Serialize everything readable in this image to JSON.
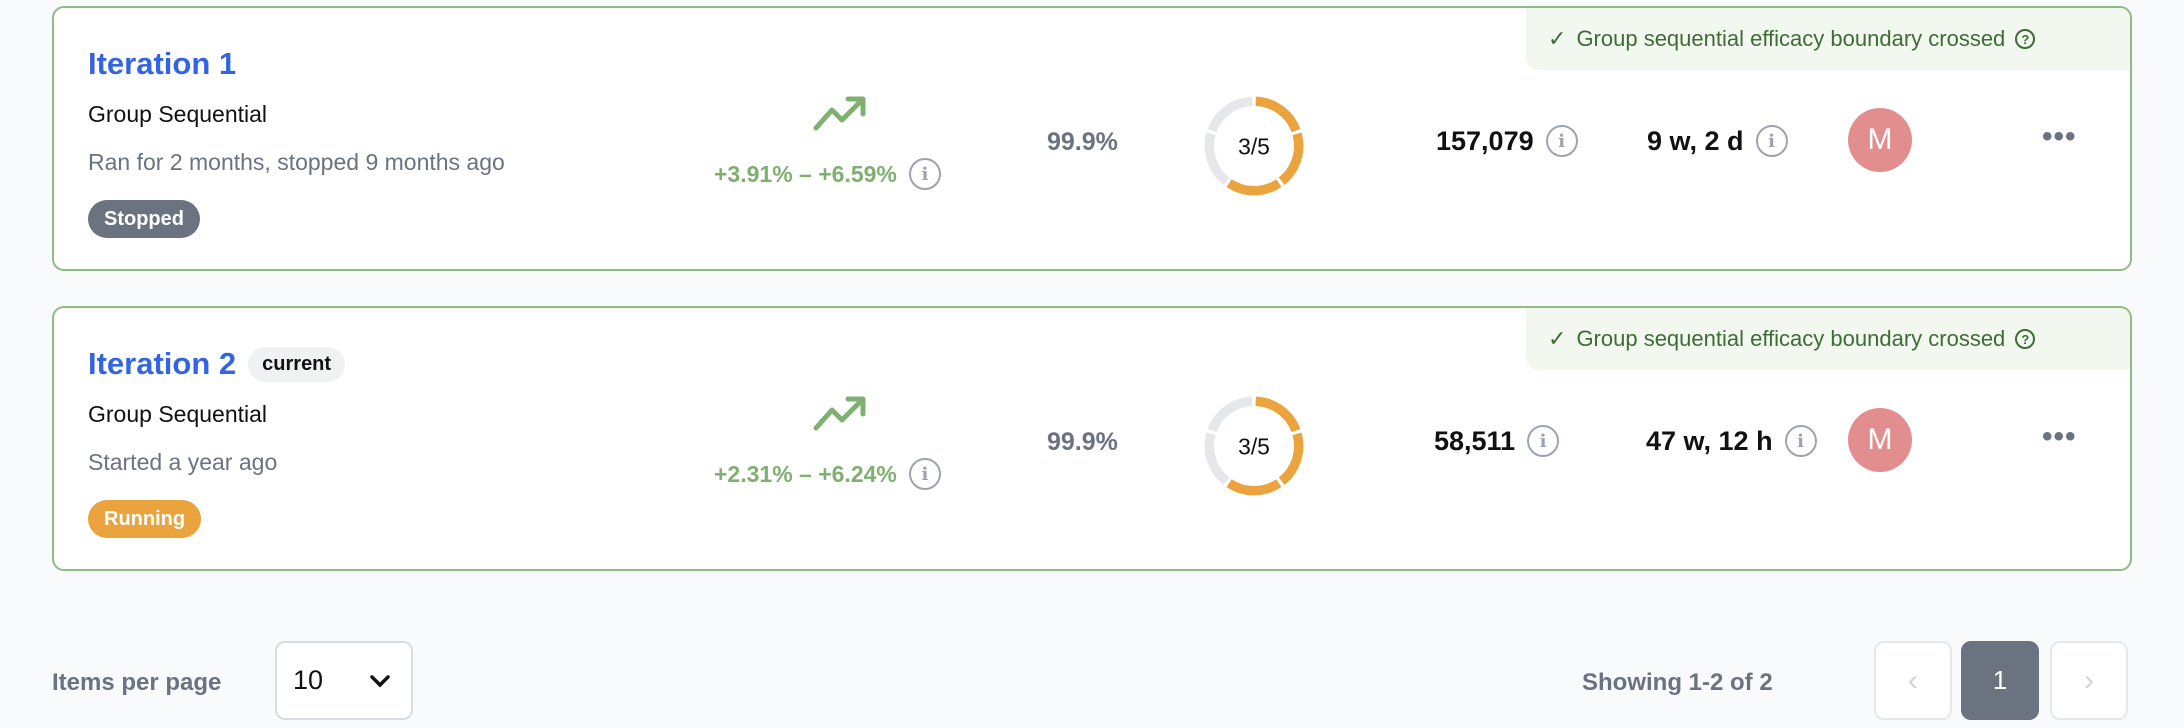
{
  "iterations": [
    {
      "title": "Iteration 1",
      "current_label": "",
      "method": "Group Sequential",
      "subtitle": "Ran for 2 months, stopped 9 months ago",
      "status": "Stopped",
      "status_color": "#6b7280",
      "banner": "Group sequential efficacy boundary crossed",
      "range": "+3.91% – +6.59%",
      "probability": "99.9%",
      "progress_label": "3/5",
      "progress": {
        "done": 3,
        "total": 5
      },
      "users": "157,079",
      "duration": "9 w, 2 d",
      "avatar": "M"
    },
    {
      "title": "Iteration 2",
      "current_label": "current",
      "method": "Group Sequential",
      "subtitle": "Started a year ago",
      "status": "Running",
      "status_color": "#eaa33d",
      "banner": "Group sequential efficacy boundary crossed",
      "range": "+2.31% – +6.24%",
      "probability": "99.9%",
      "progress_label": "3/5",
      "progress": {
        "done": 3,
        "total": 5
      },
      "users": "58,511",
      "duration": "47 w, 12 h",
      "avatar": "M"
    }
  ],
  "footer": {
    "items_per_page_label": "Items per page",
    "items_per_page_value": "10",
    "showing": "Showing 1-2 of 2",
    "current_page": "1"
  },
  "colors": {
    "accent": "#3464e0",
    "success": "#7fb06f",
    "ring": "#eaa33d",
    "avatar": "#e38e8e"
  }
}
